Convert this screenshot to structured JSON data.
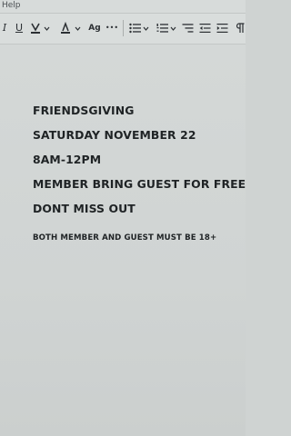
{
  "menu": {
    "help_label": "Help"
  },
  "toolbar": {
    "italic_label": "I",
    "underline_label": "U",
    "more_label": "•••",
    "style_label": "Ag"
  },
  "document": {
    "lines": [
      "FRIENDSGIVING",
      "SATURDAY NOVEMBER 22",
      "8AM-12PM",
      "MEMBER BRING GUEST FOR FREE",
      "DONT MISS OUT"
    ],
    "note": "BOTH MEMBER AND GUEST MUST BE 18+"
  },
  "colors": {
    "text": "#1f2325",
    "page_background": "#d0d4d3",
    "toolbar_background": "#d9dddc"
  }
}
